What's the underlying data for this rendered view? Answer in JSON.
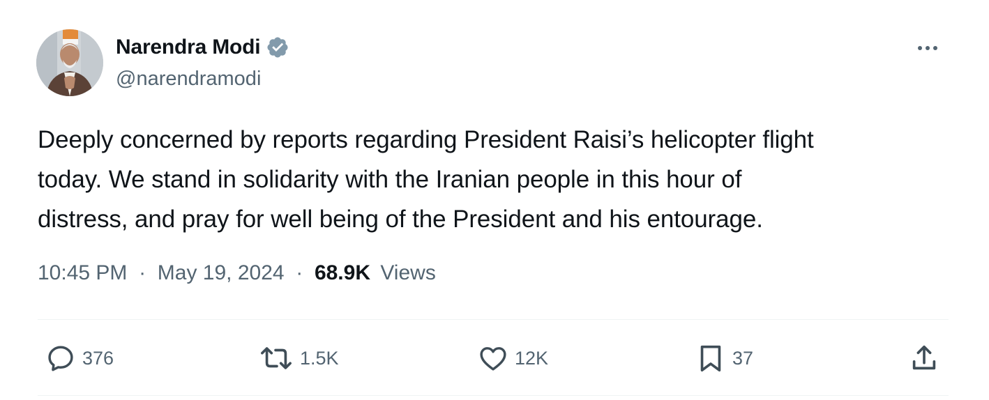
{
  "user": {
    "display_name": "Narendra Modi",
    "handle": "@narendramodi",
    "verified": true
  },
  "icons": {
    "avatar": "profile-photo",
    "verified": "verified-badge-icon",
    "more": "more-options-icon",
    "reply": "reply-icon",
    "retweet": "retweet-icon",
    "like": "heart-icon",
    "bookmark": "bookmark-icon",
    "share": "share-icon"
  },
  "tweet": {
    "lines": [
      "Deeply concerned by reports regarding President Raisi’s helicopter flight",
      "today. We stand in solidarity with the Iranian people in this hour of",
      "distress, and pray for well being of the President and his entourage."
    ],
    "time": "10:45 PM",
    "date": "May 19, 2024",
    "separator": "·",
    "views_count": "68.9K",
    "views_label": "Views"
  },
  "actions": {
    "replies": "376",
    "reposts": "1.5K",
    "likes": "12K",
    "bookmarks": "37"
  },
  "colors": {
    "text_primary": "#0f1419",
    "text_secondary": "#536471",
    "verified_badge": "#829aab",
    "divider": "#eff3f4"
  }
}
